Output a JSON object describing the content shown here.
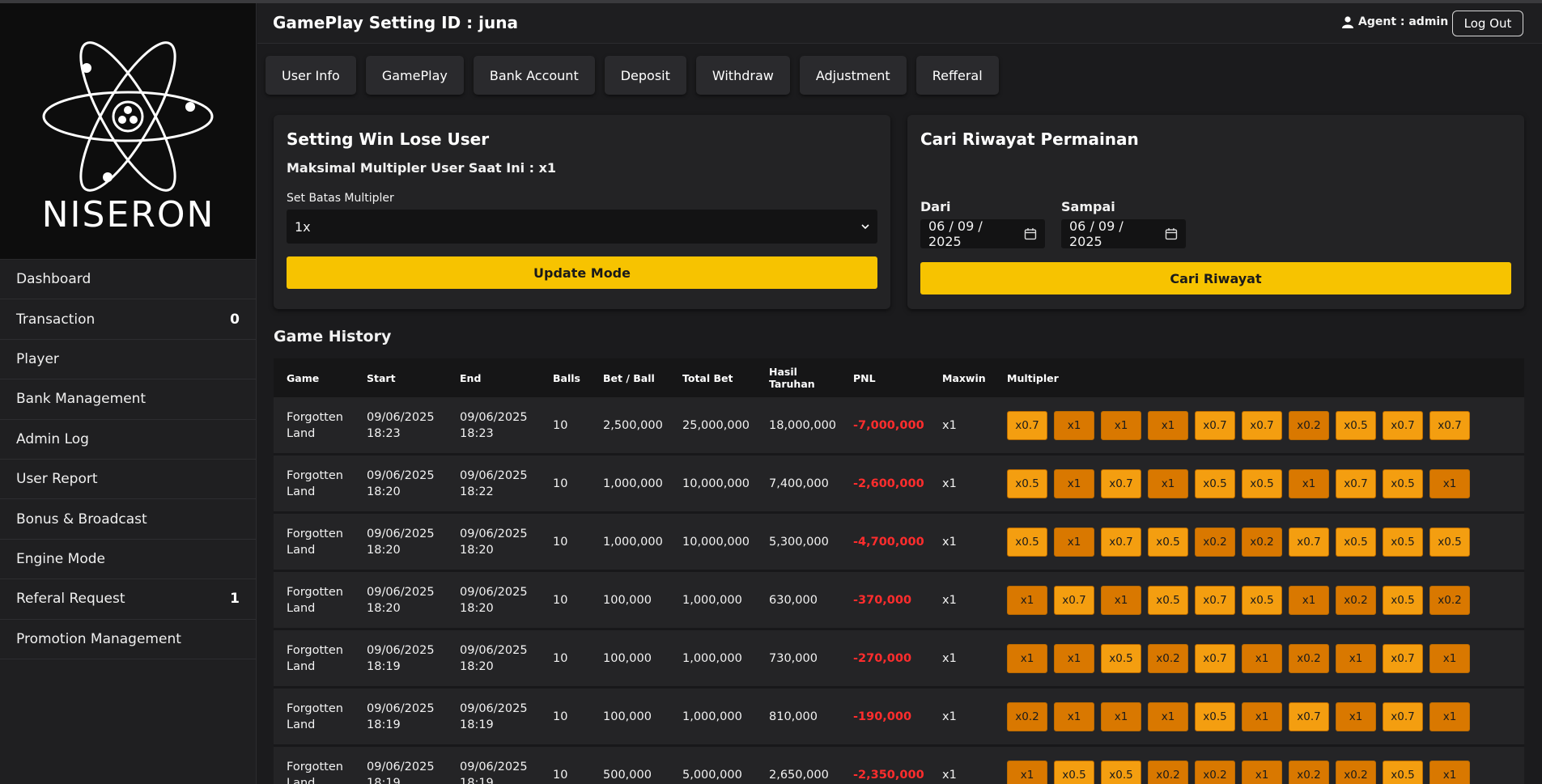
{
  "brand": {
    "name": "NISERON"
  },
  "sidebar": {
    "items": [
      {
        "label": "Dashboard",
        "count": ""
      },
      {
        "label": "Transaction",
        "count": "0"
      },
      {
        "label": "Player",
        "count": ""
      },
      {
        "label": "Bank Management",
        "count": ""
      },
      {
        "label": "Admin Log",
        "count": ""
      },
      {
        "label": "User Report",
        "count": ""
      },
      {
        "label": "Bonus & Broadcast",
        "count": ""
      },
      {
        "label": "Engine Mode",
        "count": ""
      },
      {
        "label": "Referal Request",
        "count": "1"
      },
      {
        "label": "Promotion Management",
        "count": ""
      }
    ]
  },
  "header": {
    "title": "GamePlay Setting ID : juna",
    "agent": "Agent : admin",
    "logout": "Log Out"
  },
  "tabs": [
    "User Info",
    "GamePlay",
    "Bank Account",
    "Deposit",
    "Withdraw",
    "Adjustment",
    "Refferal"
  ],
  "winlose": {
    "title": "Setting Win Lose User",
    "current": "Maksimal Multipler User Saat Ini : x1",
    "field_label": "Set Batas Multipler",
    "selected": "1x",
    "button": "Update Mode"
  },
  "search": {
    "title": "Cari Riwayat Permainan",
    "from_label": "Dari",
    "from_value": "06 / 09 / 2025",
    "to_label": "Sampai",
    "to_value": "06 / 09 / 2025",
    "button": "Cari Riwayat"
  },
  "history": {
    "title": "Game History",
    "columns": [
      "Game",
      "Start",
      "End",
      "Balls",
      "Bet / Ball",
      "Total Bet",
      "Hasil Taruhan",
      "PNL",
      "Maxwin",
      "Multipler"
    ],
    "rows": [
      {
        "game": "Forgotten Land",
        "start": "09/06/2025 18:23",
        "end": "09/06/2025 18:23",
        "balls": "10",
        "bet": "2,500,000",
        "total": "25,000,000",
        "hasil": "18,000,000",
        "pnl": "-7,000,000",
        "maxwin": "x1",
        "mult": [
          "x0.7",
          "x1",
          "x1",
          "x1",
          "x0.7",
          "x0.7",
          "x0.2",
          "x0.5",
          "x0.7",
          "x0.7"
        ]
      },
      {
        "game": "Forgotten Land",
        "start": "09/06/2025 18:20",
        "end": "09/06/2025 18:22",
        "balls": "10",
        "bet": "1,000,000",
        "total": "10,000,000",
        "hasil": "7,400,000",
        "pnl": "-2,600,000",
        "maxwin": "x1",
        "mult": [
          "x0.5",
          "x1",
          "x0.7",
          "x1",
          "x0.5",
          "x0.5",
          "x1",
          "x0.7",
          "x0.5",
          "x1"
        ]
      },
      {
        "game": "Forgotten Land",
        "start": "09/06/2025 18:20",
        "end": "09/06/2025 18:20",
        "balls": "10",
        "bet": "1,000,000",
        "total": "10,000,000",
        "hasil": "5,300,000",
        "pnl": "-4,700,000",
        "maxwin": "x1",
        "mult": [
          "x0.5",
          "x1",
          "x0.7",
          "x0.5",
          "x0.2",
          "x0.2",
          "x0.7",
          "x0.5",
          "x0.5",
          "x0.5"
        ]
      },
      {
        "game": "Forgotten Land",
        "start": "09/06/2025 18:20",
        "end": "09/06/2025 18:20",
        "balls": "10",
        "bet": "100,000",
        "total": "1,000,000",
        "hasil": "630,000",
        "pnl": "-370,000",
        "maxwin": "x1",
        "mult": [
          "x1",
          "x0.7",
          "x1",
          "x0.5",
          "x0.7",
          "x0.5",
          "x1",
          "x0.2",
          "x0.5",
          "x0.2"
        ]
      },
      {
        "game": "Forgotten Land",
        "start": "09/06/2025 18:19",
        "end": "09/06/2025 18:20",
        "balls": "10",
        "bet": "100,000",
        "total": "1,000,000",
        "hasil": "730,000",
        "pnl": "-270,000",
        "maxwin": "x1",
        "mult": [
          "x1",
          "x1",
          "x0.5",
          "x0.2",
          "x0.7",
          "x1",
          "x0.2",
          "x1",
          "x0.7",
          "x1"
        ]
      },
      {
        "game": "Forgotten Land",
        "start": "09/06/2025 18:19",
        "end": "09/06/2025 18:19",
        "balls": "10",
        "bet": "100,000",
        "total": "1,000,000",
        "hasil": "810,000",
        "pnl": "-190,000",
        "maxwin": "x1",
        "mult": [
          "x0.2",
          "x1",
          "x1",
          "x1",
          "x0.5",
          "x1",
          "x0.7",
          "x1",
          "x0.7",
          "x1"
        ]
      },
      {
        "game": "Forgotten Land",
        "start": "09/06/2025 18:19",
        "end": "09/06/2025 18:19",
        "balls": "10",
        "bet": "500,000",
        "total": "5,000,000",
        "hasil": "2,650,000",
        "pnl": "-2,350,000",
        "maxwin": "x1",
        "mult": [
          "x1",
          "x0.5",
          "x0.5",
          "x0.2",
          "x0.2",
          "x1",
          "x0.2",
          "x0.2",
          "x0.5",
          "x1"
        ]
      }
    ]
  },
  "colors": {
    "accent": "#f7c300",
    "loss": "#ff2d2d",
    "chip_warm": "#f49e10",
    "chip_low": "#d97800"
  }
}
